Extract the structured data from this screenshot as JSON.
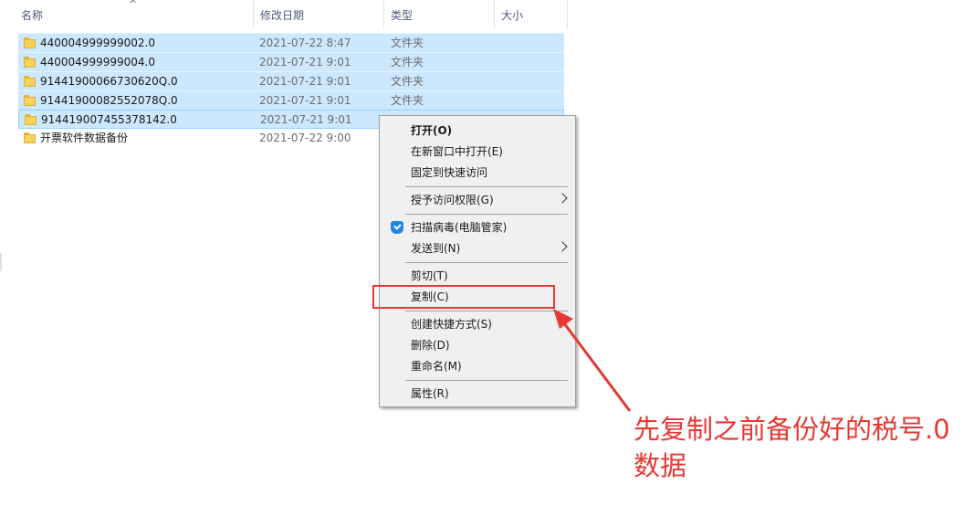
{
  "columns": {
    "name": "名称",
    "date": "修改日期",
    "type": "类型",
    "size": "大小",
    "sort_glyph": "^"
  },
  "files": [
    {
      "name": "440004999999002.0",
      "date": "2021-07-22 8:47",
      "type": "文件夹",
      "selected": true
    },
    {
      "name": "440004999999004.0",
      "date": "2021-07-21 9:01",
      "type": "文件夹",
      "selected": true
    },
    {
      "name": "91441900066730620Q.0",
      "date": "2021-07-21 9:01",
      "type": "文件夹",
      "selected": true
    },
    {
      "name": "91441900082552078Q.0",
      "date": "2021-07-21 9:01",
      "type": "文件夹",
      "selected": true
    },
    {
      "name": "914419007455378142.0",
      "date": "2021-07-21 9:01",
      "type": "",
      "selected": true
    },
    {
      "name": "开票软件数据备份",
      "date": "2021-07-22 9:00",
      "type": "",
      "selected": false
    }
  ],
  "context_menu": {
    "open": "打开(O)",
    "open_new_window": "在新窗口中打开(E)",
    "pin_quick_access": "固定到快速访问",
    "grant_access": "授予访问权限(G)",
    "scan_virus": "扫描病毒(电脑管家)",
    "send_to": "发送到(N)",
    "cut": "剪切(T)",
    "copy": "复制(C)",
    "create_shortcut": "创建快捷方式(S)",
    "delete": "删除(D)",
    "rename": "重命名(M)",
    "properties": "属性(R)"
  },
  "annotation": {
    "line1": "先复制之前备份好的税号.0",
    "line2": "数据",
    "color": "#e53935"
  },
  "colors": {
    "selection": "#cce8ff",
    "menu_bg": "#f0f0f0",
    "folder": "#f8d15a"
  }
}
